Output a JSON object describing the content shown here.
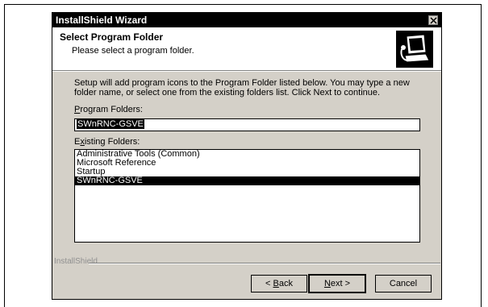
{
  "window": {
    "title": "InstallShield Wizard"
  },
  "header": {
    "title": "Select Program Folder",
    "subtitle": "Please select a program folder."
  },
  "main": {
    "description": "Setup will add program icons to the Program Folder listed below.  You may type a new folder name, or select one from the existing folders list.  Click Next to continue.",
    "program_folders_label_accel": "P",
    "program_folders_label_rest": "rogram Folders:",
    "program_folder_value": "SWnRNC-GSVE",
    "existing_folders_label_pre": "E",
    "existing_folders_label_accel": "x",
    "existing_folders_label_rest": "isting Folders:",
    "existing_folders": [
      "Administrative Tools (Common)",
      "Microsoft Reference",
      "Startup",
      "SWnRNC-GSVE"
    ],
    "selected_folder_index": 3
  },
  "footer": {
    "brand": "InstallShield",
    "back_prefix": "< ",
    "back_accel": "B",
    "back_rest": "ack",
    "next_accel": "N",
    "next_rest": "ext >",
    "cancel_label": "Cancel"
  },
  "icons": {
    "close": "close-icon",
    "logo": "installer-computer-icon"
  }
}
